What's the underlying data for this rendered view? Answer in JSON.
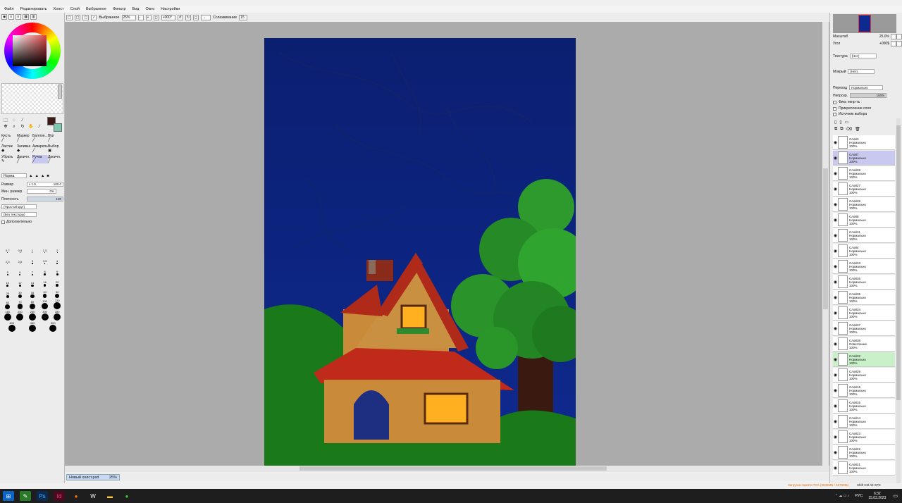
{
  "menu": [
    "Файл",
    "Редактировать",
    "Холст",
    "Слой",
    "Выбранное",
    "Фильтр",
    "Вид",
    "Окно",
    "Настройки"
  ],
  "toolbar": {
    "selected_label": "Выбранное",
    "zoom": "25%",
    "rotation": "+000°",
    "smoothing_label": "Сглаживание",
    "smoothing_value": "15"
  },
  "tools": {
    "brushes": [
      "Кисть",
      "Маркер",
      "Баллон...",
      "Blur",
      "Ластик",
      "Заливка",
      "Акварель",
      "Выбор",
      "Убрать",
      "Двоичн.",
      "Ручка",
      "Двоичн."
    ],
    "mode": "Норма",
    "size_label": "Размер",
    "size_mult": "x 1.0",
    "size_value": "100.0",
    "min_size_label": "Мин. размер",
    "min_size_value": "0%",
    "density_label": "Плотность",
    "density_value": "100",
    "shape": "(Простой круг)",
    "texture": "(Без текстуры)",
    "advanced": "Дополнительно",
    "brush_sizes": [
      [
        "0.7",
        "0.8",
        "1",
        "1.5",
        "2"
      ],
      [
        "2.3",
        "2.6",
        "3",
        "3.5",
        "4"
      ],
      [
        "5",
        "6",
        "7",
        "8",
        "9"
      ],
      [
        "10",
        "12",
        "14",
        "16",
        "20"
      ],
      [
        "25",
        "30",
        "35",
        "40",
        "50"
      ],
      [
        "60",
        "70",
        "80",
        "100",
        "120"
      ],
      [
        "160",
        "200",
        "250",
        "300",
        "350"
      ],
      [
        "400",
        "450",
        "500"
      ]
    ]
  },
  "right": {
    "scale_label": "Масштаб",
    "scale_value": "25.0%",
    "angle_label": "Угол",
    "angle_value": "+000$",
    "texture_label": "Текстура",
    "texture_value": "(Нет)",
    "wet_label": "Мокрый",
    "wet_value": "(Нет)",
    "blend_label": "Переход",
    "blend_value": "Нормально",
    "opacity_label": "Непрозр.",
    "opacity_value": "100%",
    "opacity_level": 1.0,
    "checks": [
      "Фикс непр-ть",
      "Прикрепление слоя",
      "Источник выбора"
    ]
  },
  "layers": [
    {
      "name": "Слой3",
      "mode": "Нормально",
      "opacity": "100%"
    },
    {
      "name": "Слой7",
      "mode": "Нормально",
      "opacity": "100%"
    },
    {
      "name": "Слой28",
      "mode": "Нормально",
      "opacity": "100%"
    },
    {
      "name": "Слой27",
      "mode": "Нормально",
      "opacity": "100%"
    },
    {
      "name": "Слой26",
      "mode": "Нормально",
      "opacity": "100%"
    },
    {
      "name": "Слой8",
      "mode": "Нормально",
      "opacity": "100%"
    },
    {
      "name": "Слой11",
      "mode": "Нормально",
      "opacity": "100%"
    },
    {
      "name": "Слой4",
      "mode": "Нормально",
      "opacity": "100%"
    },
    {
      "name": "Слой33",
      "mode": "Нормально",
      "opacity": "100%"
    },
    {
      "name": "Слой36",
      "mode": "Нормально",
      "opacity": "100%"
    },
    {
      "name": "Слой35",
      "mode": "Нормально",
      "opacity": "100%"
    },
    {
      "name": "Слой34",
      "mode": "Нормально",
      "opacity": "100%"
    },
    {
      "name": "Слой37",
      "mode": "Нормально",
      "opacity": "100%"
    },
    {
      "name": "Слой38",
      "mode": "Осветление",
      "opacity": "100%"
    },
    {
      "name": "Слой32",
      "mode": "Нормально",
      "opacity": "100%"
    },
    {
      "name": "Слой29",
      "mode": "Нормально",
      "opacity": "100%"
    },
    {
      "name": "Слой16",
      "mode": "Нормально",
      "opacity": "100%"
    },
    {
      "name": "Слой15",
      "mode": "Нормально",
      "opacity": "100%"
    },
    {
      "name": "Слой14",
      "mode": "Нормально",
      "opacity": "100%"
    },
    {
      "name": "Слой23",
      "mode": "Нормально",
      "opacity": "100%"
    },
    {
      "name": "Слой22",
      "mode": "Нормально",
      "opacity": "100%"
    },
    {
      "name": "Слой21",
      "mode": "Нормально",
      "opacity": "100%"
    }
  ],
  "status": {
    "file": "Новый холст.psd",
    "zoom": "25%",
    "memory": "Загрузка памяти:79% (3938МБ / 4979МБ)",
    "keys": "Shift Ctrl Alt SPC"
  },
  "taskbar": {
    "lang": "РУС",
    "time": "6:32",
    "date": "15.03.2023"
  },
  "colors": {
    "primary": "#3a1a12",
    "secondary": "#7fc8b0",
    "sky": "#0b1f70",
    "grass": "#1a7a1a"
  }
}
